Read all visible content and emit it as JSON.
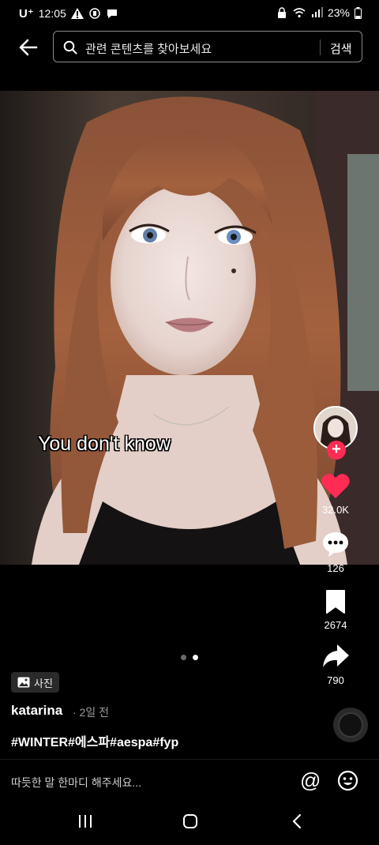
{
  "status": {
    "carrier": "U⁺",
    "time": "12:05",
    "battery": "23%"
  },
  "search": {
    "placeholder": "관련 콘텐츠를 찾아보세요",
    "button": "검색"
  },
  "post": {
    "overlay_text": "You don't know",
    "badge": "사진",
    "author": "katarina",
    "time": "· 2일 전",
    "hashtags": "#WINTER#에스파#aespa#fyp",
    "slide_index": 2,
    "slide_count": 2
  },
  "actions": {
    "likes": "32.0K",
    "comments": "126",
    "saves": "2674",
    "shares": "790"
  },
  "comment": {
    "placeholder": "따듯한 말 한마디 해주세요...",
    "at_symbol": "@"
  },
  "colors": {
    "like": "#fe2c55",
    "background": "#000000"
  },
  "icons": [
    "back-arrow-icon",
    "search-icon",
    "heart-icon",
    "comment-icon",
    "bookmark-icon",
    "share-icon",
    "emoji-icon",
    "image-icon"
  ]
}
